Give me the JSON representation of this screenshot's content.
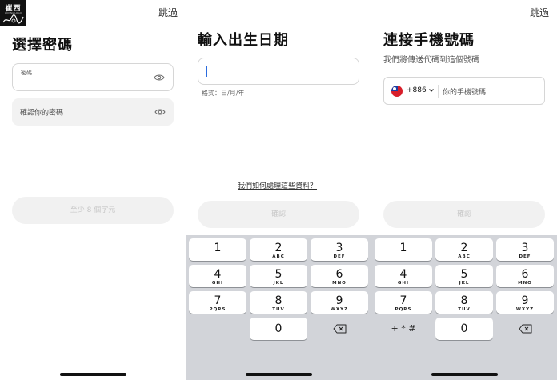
{
  "panel1": {
    "logo": {
      "text": "崔西",
      "subtext": "LOVING LOGO"
    },
    "skip": "跳過",
    "title": "選擇密碼",
    "password_label": "密碼",
    "confirm_placeholder": "確認你的密碼",
    "submit_label": "至少 8 個字元"
  },
  "panel2": {
    "title": "輸入出生日期",
    "format_hint": "格式：日/月/年",
    "privacy_link": "我們如何處理這些資料？",
    "confirm_label": "確認"
  },
  "panel3": {
    "skip": "跳過",
    "title": "連接手機號碼",
    "subtitle": "我們將傳送代碼到這個號碼",
    "country_code": "+886",
    "phone_placeholder": "你的手機號碼",
    "confirm_label": "確認"
  },
  "keypad": {
    "keys": [
      {
        "num": "1",
        "letters": ""
      },
      {
        "num": "2",
        "letters": "ABC"
      },
      {
        "num": "3",
        "letters": "DEF"
      },
      {
        "num": "4",
        "letters": "GHI"
      },
      {
        "num": "5",
        "letters": "JKL"
      },
      {
        "num": "6",
        "letters": "MNO"
      },
      {
        "num": "7",
        "letters": "PQRS"
      },
      {
        "num": "8",
        "letters": "TUV"
      },
      {
        "num": "9",
        "letters": "WXYZ"
      },
      {
        "num": "0",
        "letters": ""
      }
    ],
    "symbols_label": "+ * #"
  },
  "colors": {
    "accent": "#2b6cde",
    "disabled_bg": "#f1f1f1",
    "disabled_text": "#c7c7c7",
    "keypad_bg": "#d2d4d9"
  }
}
